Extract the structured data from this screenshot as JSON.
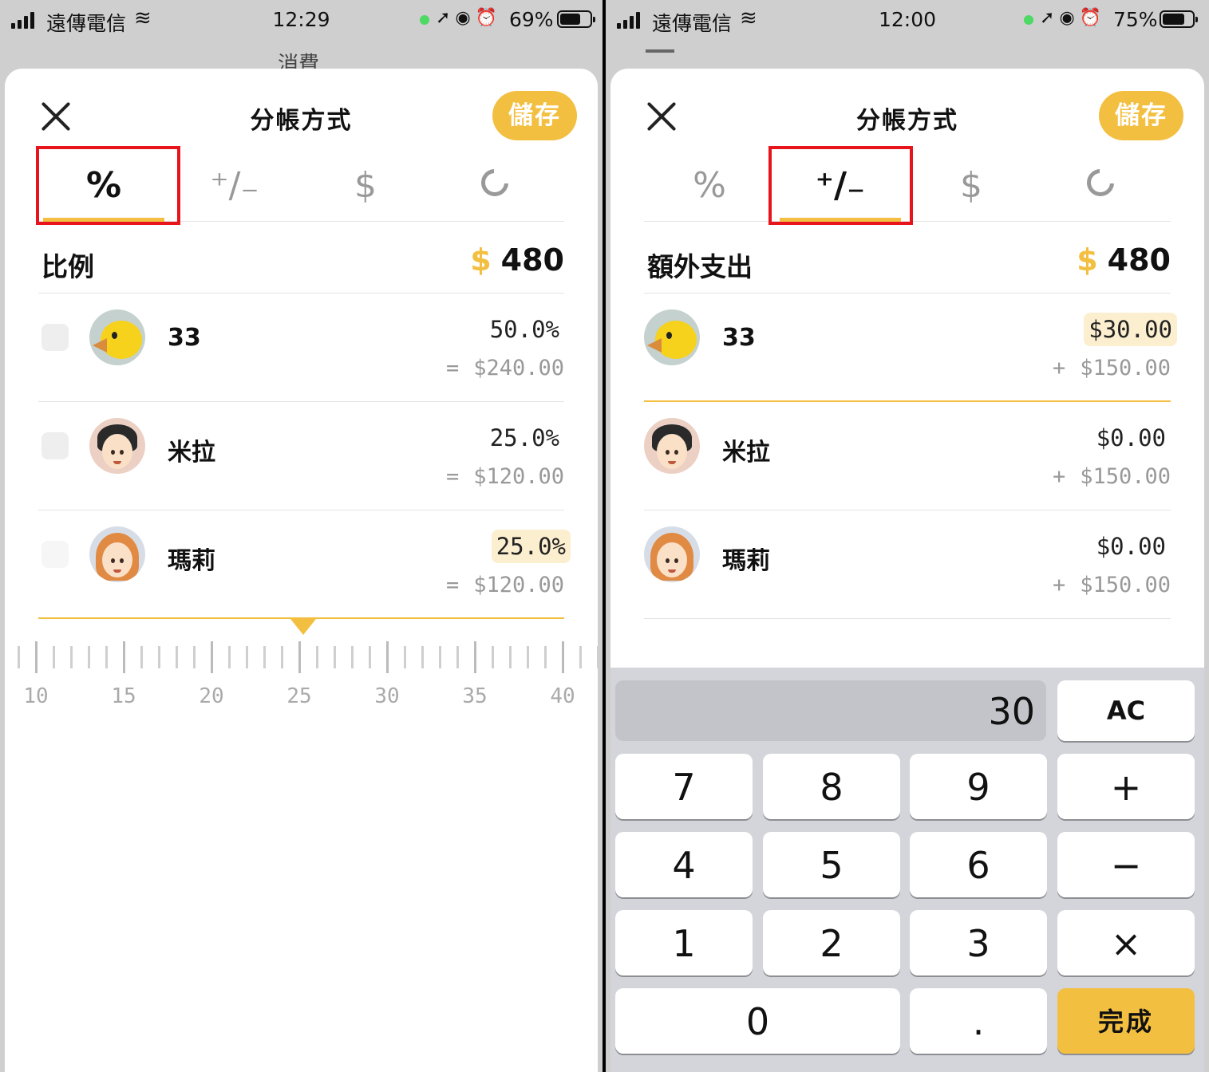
{
  "left": {
    "status": {
      "carrier": "遠傳電信",
      "time": "12:29",
      "battery": "69%",
      "battery_fraction": 0.69
    },
    "behind_title": "消費",
    "sheet": {
      "title": "分帳方式",
      "save": "儲存",
      "tabs": [
        {
          "name": "percent",
          "glyph": "%",
          "active": true
        },
        {
          "name": "adjust",
          "glyph": "⁺∕₋",
          "active": false
        },
        {
          "name": "amount",
          "glyph": "$",
          "active": false
        },
        {
          "name": "share",
          "glyph": "",
          "active": false
        }
      ],
      "summary": {
        "label": "比例",
        "currency": "$",
        "total": "480"
      },
      "rows": [
        {
          "name": "33",
          "value": "50.0%",
          "sub_op": "=",
          "sub": "$240.00"
        },
        {
          "name": "米拉",
          "value": "25.0%",
          "sub_op": "=",
          "sub": "$120.00"
        },
        {
          "name": "瑪莉",
          "value": "25.0%",
          "sub_op": "=",
          "sub": "$120.00"
        }
      ],
      "ruler": {
        "labels": [
          "10",
          "15",
          "20",
          "25",
          "30",
          "35",
          "40"
        ],
        "selected": 25
      }
    }
  },
  "right": {
    "status": {
      "carrier": "遠傳電信",
      "time": "12:00",
      "battery": "75%",
      "battery_fraction": 0.75
    },
    "sheet": {
      "title": "分帳方式",
      "save": "儲存",
      "summary": {
        "label": "額外支出",
        "currency": "$",
        "total": "480"
      },
      "rows": [
        {
          "name": "33",
          "value": "$30.00",
          "sub_op": "+",
          "sub": "$150.00"
        },
        {
          "name": "米拉",
          "value": "$0.00",
          "sub_op": "+",
          "sub": "$150.00"
        },
        {
          "name": "瑪莉",
          "value": "$0.00",
          "sub_op": "+",
          "sub": "$150.00"
        }
      ]
    },
    "keypad": {
      "display": "30",
      "clear": "AC",
      "keys": {
        "k7": "7",
        "k8": "8",
        "k9": "9",
        "plus": "+",
        "k4": "4",
        "k5": "5",
        "k6": "6",
        "minus": "−",
        "k1": "1",
        "k2": "2",
        "k3": "3",
        "times": "×",
        "k0": "0",
        "dot": ".",
        "done": "完成"
      }
    }
  },
  "icons": {
    "close": "close-icon",
    "wifi": "wifi-icon",
    "location": "location-icon",
    "lock": "rotation-lock-icon",
    "alarm": "alarm-icon",
    "percent_tab": "percent-icon",
    "adjust_tab": "plus-minus-icon",
    "amount_tab": "dollar-icon",
    "share_tab": "pie-icon"
  },
  "colors": {
    "accent": "#f3bf41",
    "highlight": "#fcefcf",
    "annotation": "#e8141c",
    "status_dot": "#4cd964"
  }
}
